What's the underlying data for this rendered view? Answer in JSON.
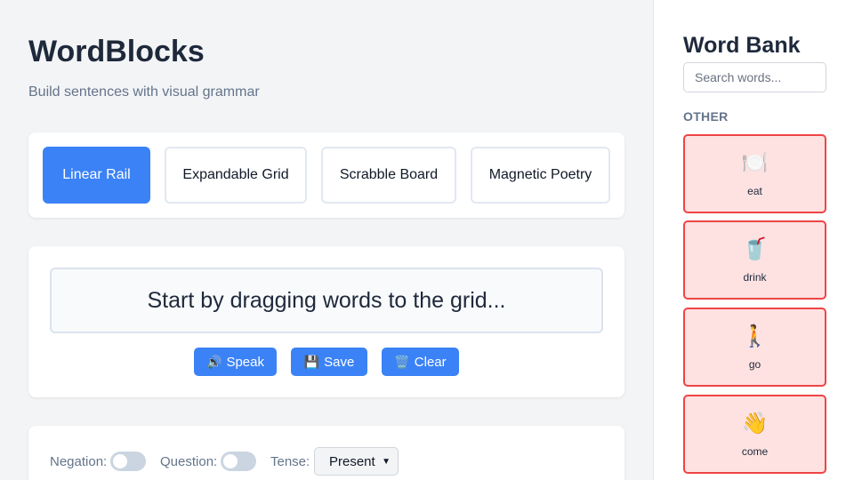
{
  "app": {
    "title": "WordBlocks",
    "subtitle": "Build sentences with visual grammar"
  },
  "modes": [
    {
      "label": "Linear Rail",
      "active": true
    },
    {
      "label": "Expandable Grid",
      "active": false
    },
    {
      "label": "Scrabble Board",
      "active": false
    },
    {
      "label": "Magnetic Poetry",
      "active": false
    }
  ],
  "builder": {
    "placeholder": "Start by dragging words to the grid...",
    "actions": {
      "speak": {
        "icon": "🔊",
        "label": "Speak"
      },
      "save": {
        "icon": "💾",
        "label": "Save"
      },
      "clear": {
        "icon": "🗑️",
        "label": "Clear"
      }
    }
  },
  "options": {
    "negation_label": "Negation:",
    "question_label": "Question:",
    "tense_label": "Tense:",
    "tense_value": "Present",
    "negation_on": false,
    "question_on": false
  },
  "word_bank": {
    "title": "Word Bank",
    "search_placeholder": "Search words...",
    "category": "OTHER",
    "words": [
      {
        "emoji": "🍽️",
        "label": "eat",
        "icon": "plate-icon"
      },
      {
        "emoji": "🥤",
        "label": "drink",
        "icon": "cup-icon"
      },
      {
        "emoji": "🚶",
        "label": "go",
        "icon": "walking-person-icon"
      },
      {
        "emoji": "👋",
        "label": "come",
        "icon": "waving-hand-icon"
      }
    ]
  },
  "colors": {
    "accent": "#3b82f6",
    "tile_border": "#ef4444",
    "tile_bg": "#fee2e2"
  }
}
